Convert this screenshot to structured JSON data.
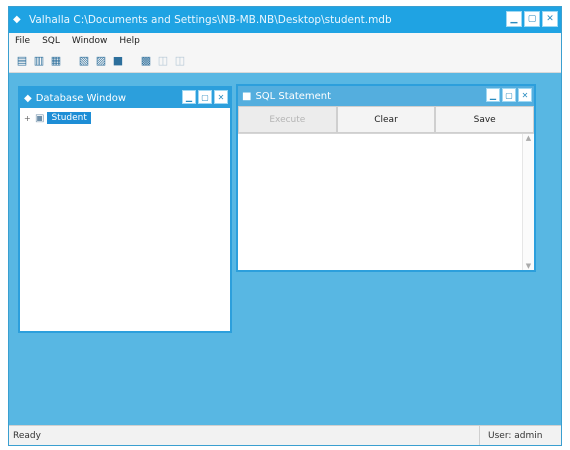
{
  "window": {
    "title": "Valhalla C:\\Documents and Settings\\NB-MB.NB\\Desktop\\student.mdb"
  },
  "menu": [
    "File",
    "SQL",
    "Window",
    "Help"
  ],
  "toolbar": {
    "icons": [
      "new-db-icon",
      "open-db-icon",
      "save-icon",
      "table-icon",
      "query-icon",
      "grid-icon",
      "print-icon",
      "refresh-icon",
      "stop-icon"
    ]
  },
  "database_window": {
    "title": "Database Window",
    "tree_root": "Student"
  },
  "sql_window": {
    "title": "SQL Statement",
    "buttons": {
      "execute": "Execute",
      "clear": "Clear",
      "save": "Save"
    }
  },
  "status": {
    "left": "Ready",
    "right": "User: admin"
  }
}
